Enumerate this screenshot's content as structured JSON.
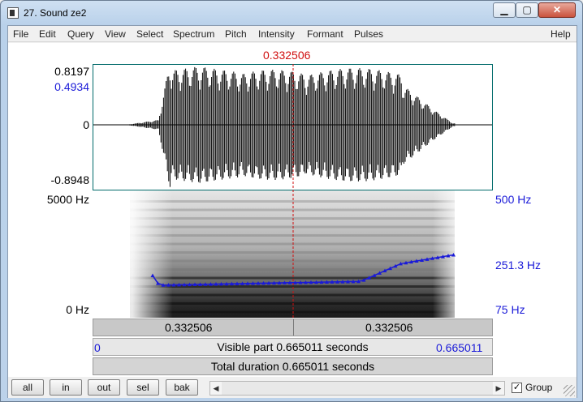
{
  "window": {
    "title": "27. Sound ze2",
    "minimize_icon": "minimize-icon",
    "maximize_icon": "maximize-icon",
    "close_icon": "close-icon"
  },
  "menu": {
    "items": [
      "File",
      "Edit",
      "Query",
      "View",
      "Select",
      "Spectrum",
      "Pitch",
      "Intensity",
      "Formant",
      "Pulses"
    ],
    "help": "Help"
  },
  "cursor": {
    "time": "0.332506",
    "fraction_of_visible": 0.5
  },
  "waveform": {
    "max_label": "0.8197",
    "cursor_value_label": "0.4934",
    "zero_label": "0",
    "min_label": "-0.8948"
  },
  "spectrogram": {
    "freq_top": "5000 Hz",
    "freq_bottom": "0 Hz",
    "pitch_top": "500 Hz",
    "pitch_cursor": "251.3 Hz",
    "pitch_bottom": "75 Hz"
  },
  "selection": {
    "left_time": "0.332506",
    "right_time": "0.332506"
  },
  "visible": {
    "start": "0",
    "end": "0.665011",
    "text": "Visible part 0.665011 seconds"
  },
  "total": {
    "text": "Total duration 0.665011 seconds"
  },
  "bottom": {
    "buttons": [
      "all",
      "in",
      "out",
      "sel",
      "bak"
    ],
    "group_label": "Group",
    "group_checked": true,
    "scroll_left_icon": "arrow-left-icon",
    "scroll_right_icon": "arrow-right-icon"
  },
  "colors": {
    "cursor": "#d01010",
    "pitch": "#1a1ad8",
    "frame": "#006a6a"
  }
}
